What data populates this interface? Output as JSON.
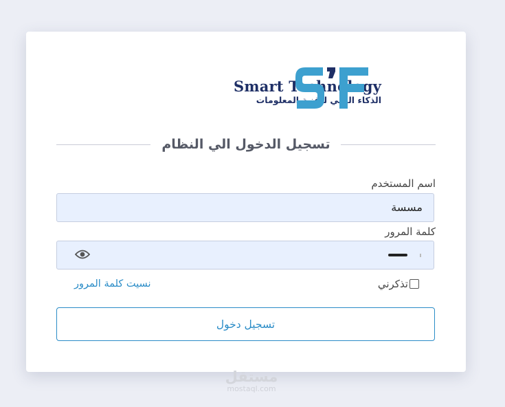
{
  "brand": {
    "name_en": "Smart Technology",
    "name_ar": "الذكاء الفني لتقنية المعلومات",
    "mark": "SF",
    "mark_color": "#3da0cf",
    "text_color": "#1e2f66"
  },
  "form": {
    "title": "تسجيل الدخول الي النظام",
    "username_label": "اسم المستخدم",
    "username_value": "مسسة",
    "password_label": "كلمة المرور",
    "remember_label": "تذكرني",
    "remember_checked": false,
    "forgot_link": "نسيت كلمة المرور",
    "submit_label": "تسجيل دخول",
    "accent_color": "#2a8cc7",
    "field_bg": "#e8f0fe"
  },
  "icons": {
    "password_toggle": "eye-icon"
  },
  "watermark": {
    "text_ar": "مستقل",
    "text_en": "mostaql.com"
  }
}
